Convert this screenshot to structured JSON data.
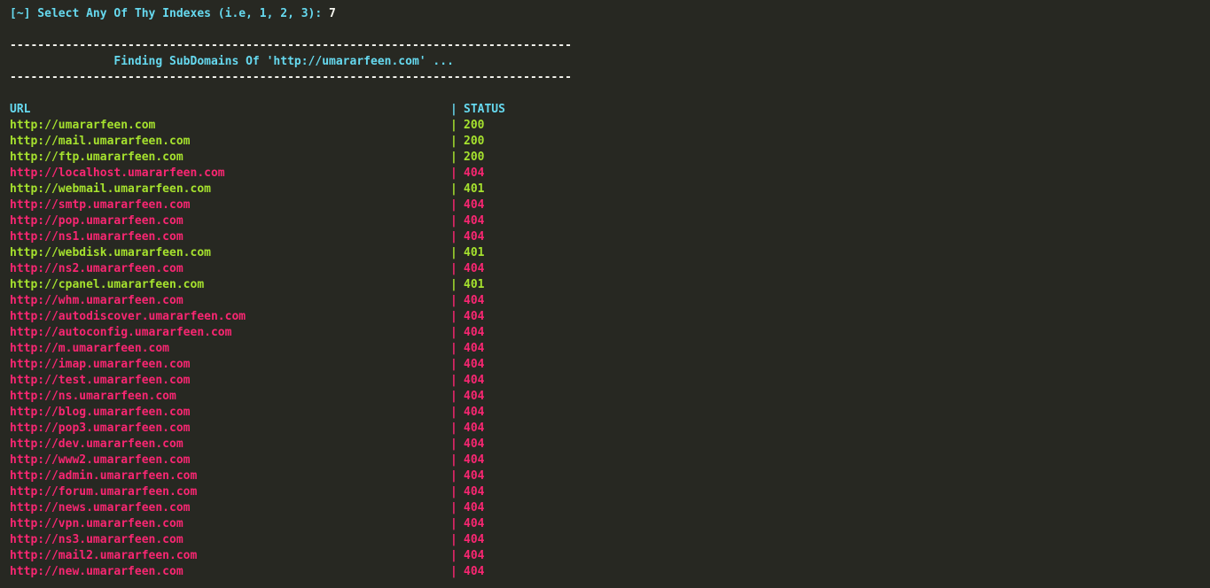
{
  "prompt": {
    "text": "[~] Select Any Of Thy Indexes (i.e, 1, 2, 3): ",
    "input": "7"
  },
  "separator": "---------------------------------------------------------------------------------",
  "banner": "               Finding SubDomains Of 'http://umararfeen.com' ...",
  "table": {
    "header_url": "URL",
    "header_pipe": "|",
    "header_status": "STATUS",
    "colors": {
      "ok": "#a6e22e",
      "fail": "#f92672",
      "header": "#66d9ef"
    },
    "rows": [
      {
        "url": "http://umararfeen.com",
        "status": "200",
        "ok": true
      },
      {
        "url": "http://mail.umararfeen.com",
        "status": "200",
        "ok": true
      },
      {
        "url": "http://ftp.umararfeen.com",
        "status": "200",
        "ok": true
      },
      {
        "url": "http://localhost.umararfeen.com",
        "status": "404",
        "ok": false
      },
      {
        "url": "http://webmail.umararfeen.com",
        "status": "401",
        "ok": true
      },
      {
        "url": "http://smtp.umararfeen.com",
        "status": "404",
        "ok": false
      },
      {
        "url": "http://pop.umararfeen.com",
        "status": "404",
        "ok": false
      },
      {
        "url": "http://ns1.umararfeen.com",
        "status": "404",
        "ok": false
      },
      {
        "url": "http://webdisk.umararfeen.com",
        "status": "401",
        "ok": true
      },
      {
        "url": "http://ns2.umararfeen.com",
        "status": "404",
        "ok": false
      },
      {
        "url": "http://cpanel.umararfeen.com",
        "status": "401",
        "ok": true
      },
      {
        "url": "http://whm.umararfeen.com",
        "status": "404",
        "ok": false
      },
      {
        "url": "http://autodiscover.umararfeen.com",
        "status": "404",
        "ok": false
      },
      {
        "url": "http://autoconfig.umararfeen.com",
        "status": "404",
        "ok": false
      },
      {
        "url": "http://m.umararfeen.com",
        "status": "404",
        "ok": false
      },
      {
        "url": "http://imap.umararfeen.com",
        "status": "404",
        "ok": false
      },
      {
        "url": "http://test.umararfeen.com",
        "status": "404",
        "ok": false
      },
      {
        "url": "http://ns.umararfeen.com",
        "status": "404",
        "ok": false
      },
      {
        "url": "http://blog.umararfeen.com",
        "status": "404",
        "ok": false
      },
      {
        "url": "http://pop3.umararfeen.com",
        "status": "404",
        "ok": false
      },
      {
        "url": "http://dev.umararfeen.com",
        "status": "404",
        "ok": false
      },
      {
        "url": "http://www2.umararfeen.com",
        "status": "404",
        "ok": false
      },
      {
        "url": "http://admin.umararfeen.com",
        "status": "404",
        "ok": false
      },
      {
        "url": "http://forum.umararfeen.com",
        "status": "404",
        "ok": false
      },
      {
        "url": "http://news.umararfeen.com",
        "status": "404",
        "ok": false
      },
      {
        "url": "http://vpn.umararfeen.com",
        "status": "404",
        "ok": false
      },
      {
        "url": "http://ns3.umararfeen.com",
        "status": "404",
        "ok": false
      },
      {
        "url": "http://mail2.umararfeen.com",
        "status": "404",
        "ok": false
      },
      {
        "url": "http://new.umararfeen.com",
        "status": "404",
        "ok": false
      }
    ]
  }
}
